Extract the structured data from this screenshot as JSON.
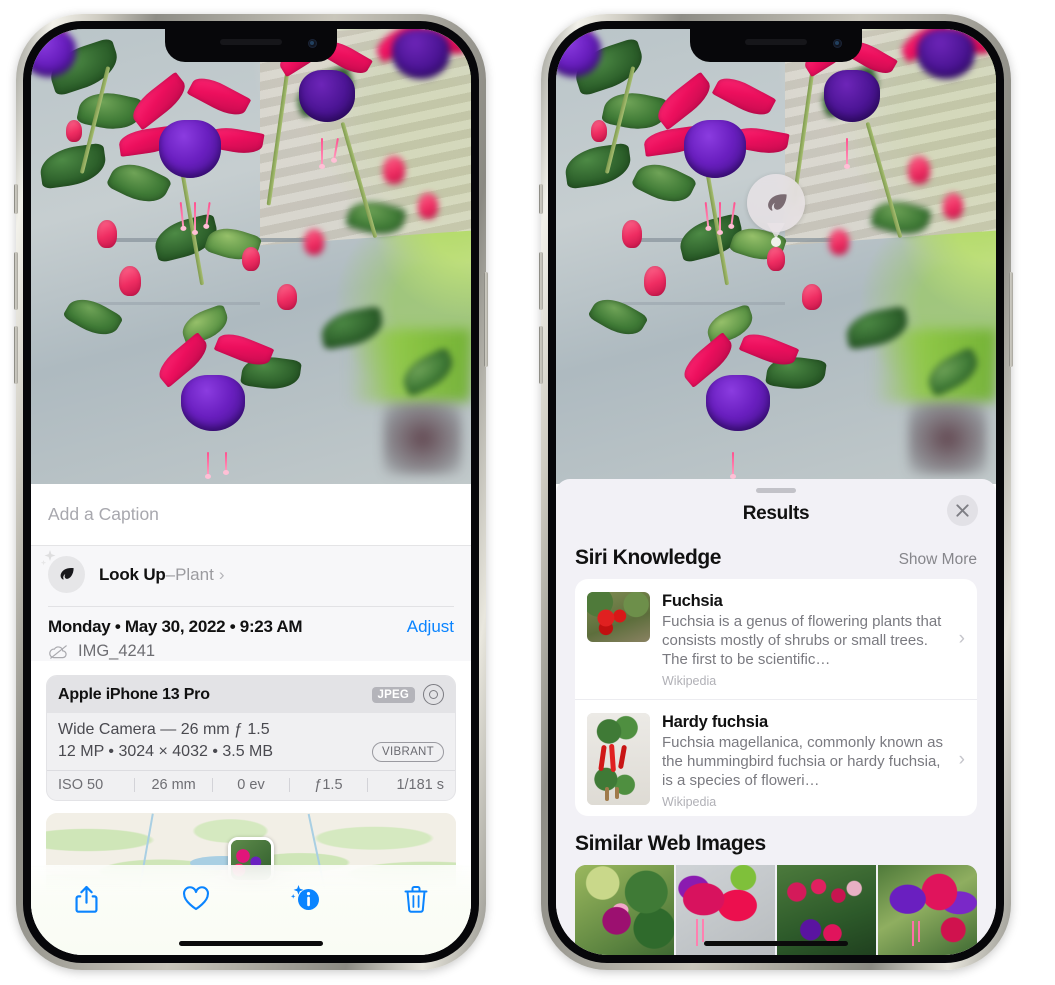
{
  "left_phone": {
    "caption": {
      "placeholder": "Add a Caption",
      "value": ""
    },
    "lookup": {
      "label": "Look Up",
      "dash": " – ",
      "subject": "Plant",
      "chevron": "›",
      "icon": "leaf-icon"
    },
    "meta": {
      "date": "Monday • May 30, 2022 • 9:23 AM",
      "adjust": "Adjust",
      "filename": "IMG_4241",
      "cloud_icon": "icloud-slash-icon"
    },
    "exif": {
      "device": "Apple iPhone 13 Pro",
      "format_chip": "JPEG",
      "lens_icon": "lens-icon",
      "line1": "Wide Camera — 26 mm ƒ 1.5",
      "line2": "12 MP • 3024 × 4032 • 3.5 MB",
      "style_chip": "VIBRANT",
      "stats": [
        "ISO 50",
        "26 mm",
        "0 ev",
        "ƒ1.5",
        "1/181 s"
      ]
    },
    "toolbar": [
      {
        "name": "share-button",
        "icon": "share-icon"
      },
      {
        "name": "favorite-button",
        "icon": "heart-icon"
      },
      {
        "name": "info-button",
        "icon": "info-sparkle-icon"
      },
      {
        "name": "delete-button",
        "icon": "trash-icon"
      }
    ],
    "accent_color": "#0a84ff"
  },
  "right_phone": {
    "badge": {
      "icon": "leaf-icon",
      "name": "visual-lookup-badge"
    },
    "sheet": {
      "title": "Results",
      "close_icon": "close-icon"
    },
    "siri_knowledge": {
      "heading": "Siri Knowledge",
      "show_more": "Show More",
      "items": [
        {
          "title": "Fuchsia",
          "desc": "Fuchsia is a genus of flowering plants that consists mostly of shrubs or small trees. The first to be scientific…",
          "source": "Wikipedia"
        },
        {
          "title": "Hardy fuchsia",
          "desc": "Fuchsia magellanica, commonly known as the hummingbird fuchsia or hardy fuchsia, is a species of floweri…",
          "source": "Wikipedia"
        }
      ]
    },
    "similar_web_images": {
      "heading": "Similar Web Images",
      "count": 4
    }
  }
}
